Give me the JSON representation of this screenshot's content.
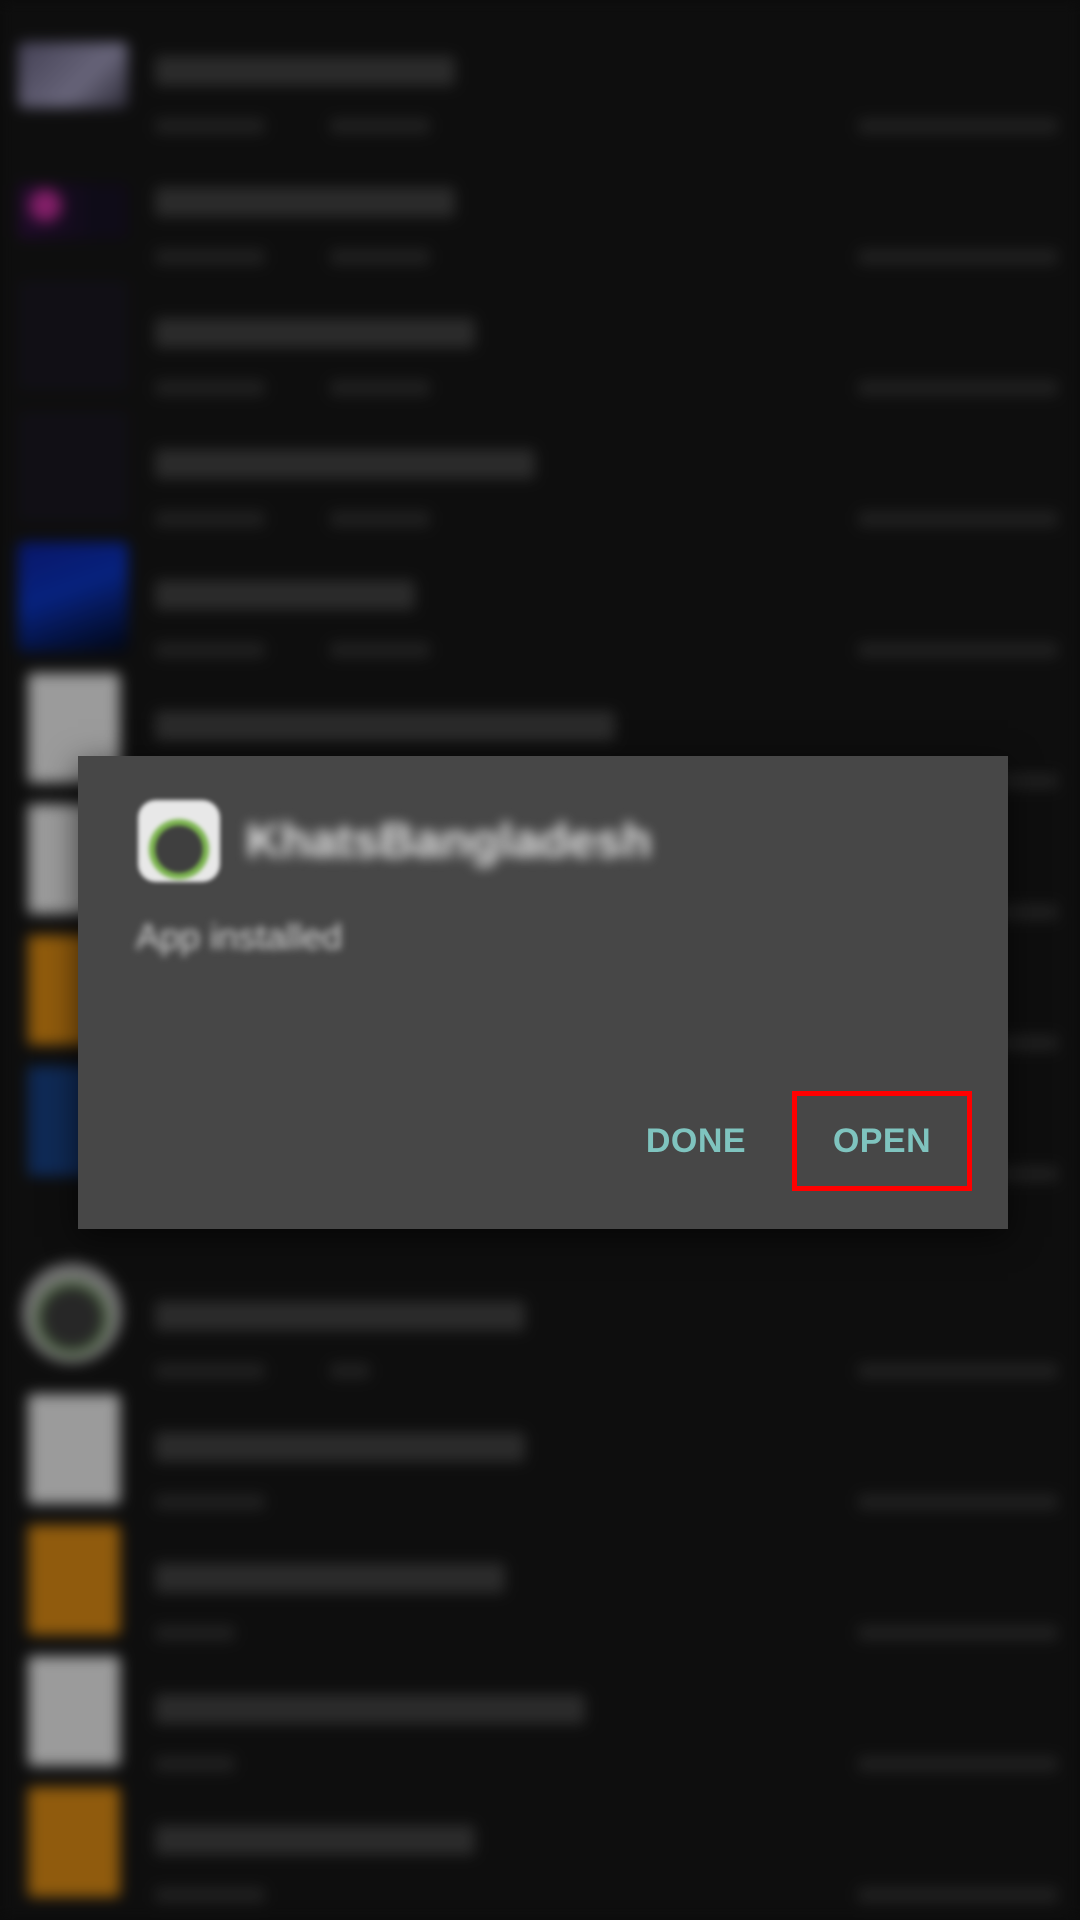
{
  "dialog": {
    "app_name": "KhatsBangladesh",
    "message": "App installed",
    "done_label": "DONE",
    "open_label": "OPEN"
  },
  "colors": {
    "dialog_bg": "#474747",
    "button_text": "#7fc4bf",
    "highlight": "#ff0000"
  }
}
